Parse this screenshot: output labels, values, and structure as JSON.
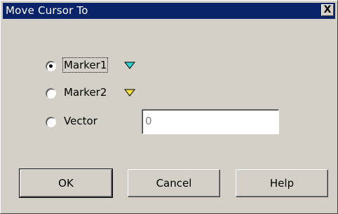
{
  "window": {
    "title": "Move Cursor To",
    "close_label": "X"
  },
  "options": [
    {
      "label": "Marker1",
      "selected": true,
      "icon": "marker1-triangle-icon",
      "icon_color": "#30d0d0"
    },
    {
      "label": "Marker2",
      "selected": false,
      "icon": "marker2-triangle-icon",
      "icon_color": "#f0e040"
    },
    {
      "label": "Vector",
      "selected": false
    }
  ],
  "vector_input": {
    "value": "0"
  },
  "buttons": {
    "ok": "OK",
    "cancel": "Cancel",
    "help": "Help"
  },
  "colors": {
    "titlebar": "#0a246a",
    "face": "#d4d0c8"
  }
}
